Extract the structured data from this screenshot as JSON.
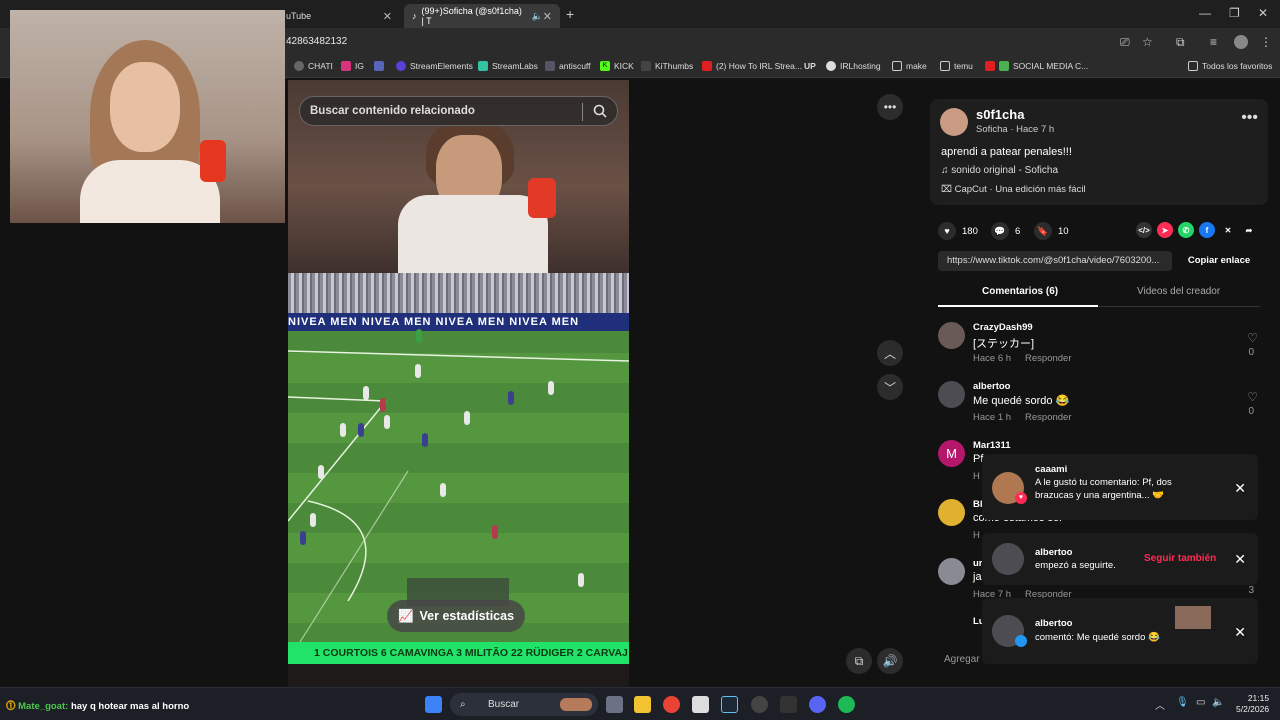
{
  "browser": {
    "tabs": [
      {
        "label": "uTube"
      },
      {
        "label": "(99+)Soficha (@s0f1cha) | T"
      }
    ],
    "url": "42863482132",
    "bookmarks": [
      "CHATI",
      "IG",
      "StreamElements",
      "StreamLabs",
      "antiscuff",
      "KICK",
      "KiThumbs",
      "(2) How To IRL Strea...",
      "UP",
      "IRLhosting",
      "make",
      "temu",
      "SOCIAL MEDIA C...",
      "Todos los favoritos"
    ]
  },
  "video": {
    "search_placeholder": "Buscar contenido relacionado",
    "banner_text": "NIVEA MEN  NIVEA MEN  NIVEA MEN  NIVEA MEN",
    "stats_button": "Ver estadísticas",
    "lineup": "1 COURTOIS  6 CAMAVINGA  3 MILITÃO  22 RÜDIGER  2 CARVAJ"
  },
  "post": {
    "username": "s0f1cha",
    "display_and_time": "Soficha · Hace 7 h",
    "caption": "aprendi a patear penales!!!",
    "sound": "sonido original - Soficha",
    "capcut": "CapCut · Una edición más fácil",
    "likes": "180",
    "comments": "6",
    "saves": "10",
    "link": "https://www.tiktok.com/@s0f1cha/video/7603200...",
    "copy_label": "Copiar enlace",
    "tab_comments": "Comentarios (6)",
    "tab_videos": "Videos del creador"
  },
  "comments": [
    {
      "user": "CrazyDash99",
      "text": "[ステッカー]",
      "time": "Hace 6 h",
      "reply": "Responder",
      "likes": "0"
    },
    {
      "user": "albertoo",
      "text": "Me quedé sordo 😂",
      "time": "Hace 1 h",
      "reply": "Responder",
      "likes": "0"
    },
    {
      "user": "Mar1311",
      "text": "Pf",
      "time": "H",
      "reply": "",
      "likes": ""
    },
    {
      "user": "Bl",
      "text": "como estamos sor",
      "time": "H",
      "reply": "",
      "likes": ""
    },
    {
      "user": "ur",
      "text": "ja",
      "time": "Hace 7 h",
      "reply": "Responder",
      "likes": "3"
    },
    {
      "user": "Lu",
      "text": "",
      "time": "",
      "reply": "",
      "likes": ""
    }
  ],
  "notifications": [
    {
      "user": "caaami",
      "text": "A le gustó tu comentario: Pf, dos brazucas y una argentina... 🤝"
    },
    {
      "user": "albertoo",
      "text": "empezó a seguirte.",
      "action": "Seguir también"
    },
    {
      "user": "albertoo",
      "text": "comentó: Me quedé sordo 😂"
    }
  ],
  "add_comment_placeholder": "Agregar",
  "taskbar": {
    "chat_user": "Mate_goat:",
    "chat_message": "hay q hotear mas al horno",
    "search": "Buscar",
    "time": "21:15",
    "date": "5/2/2026"
  },
  "colors": {
    "accent": "#fe2c55",
    "lineup_bar": "#22e36a",
    "banner": "#1f2f7a"
  }
}
